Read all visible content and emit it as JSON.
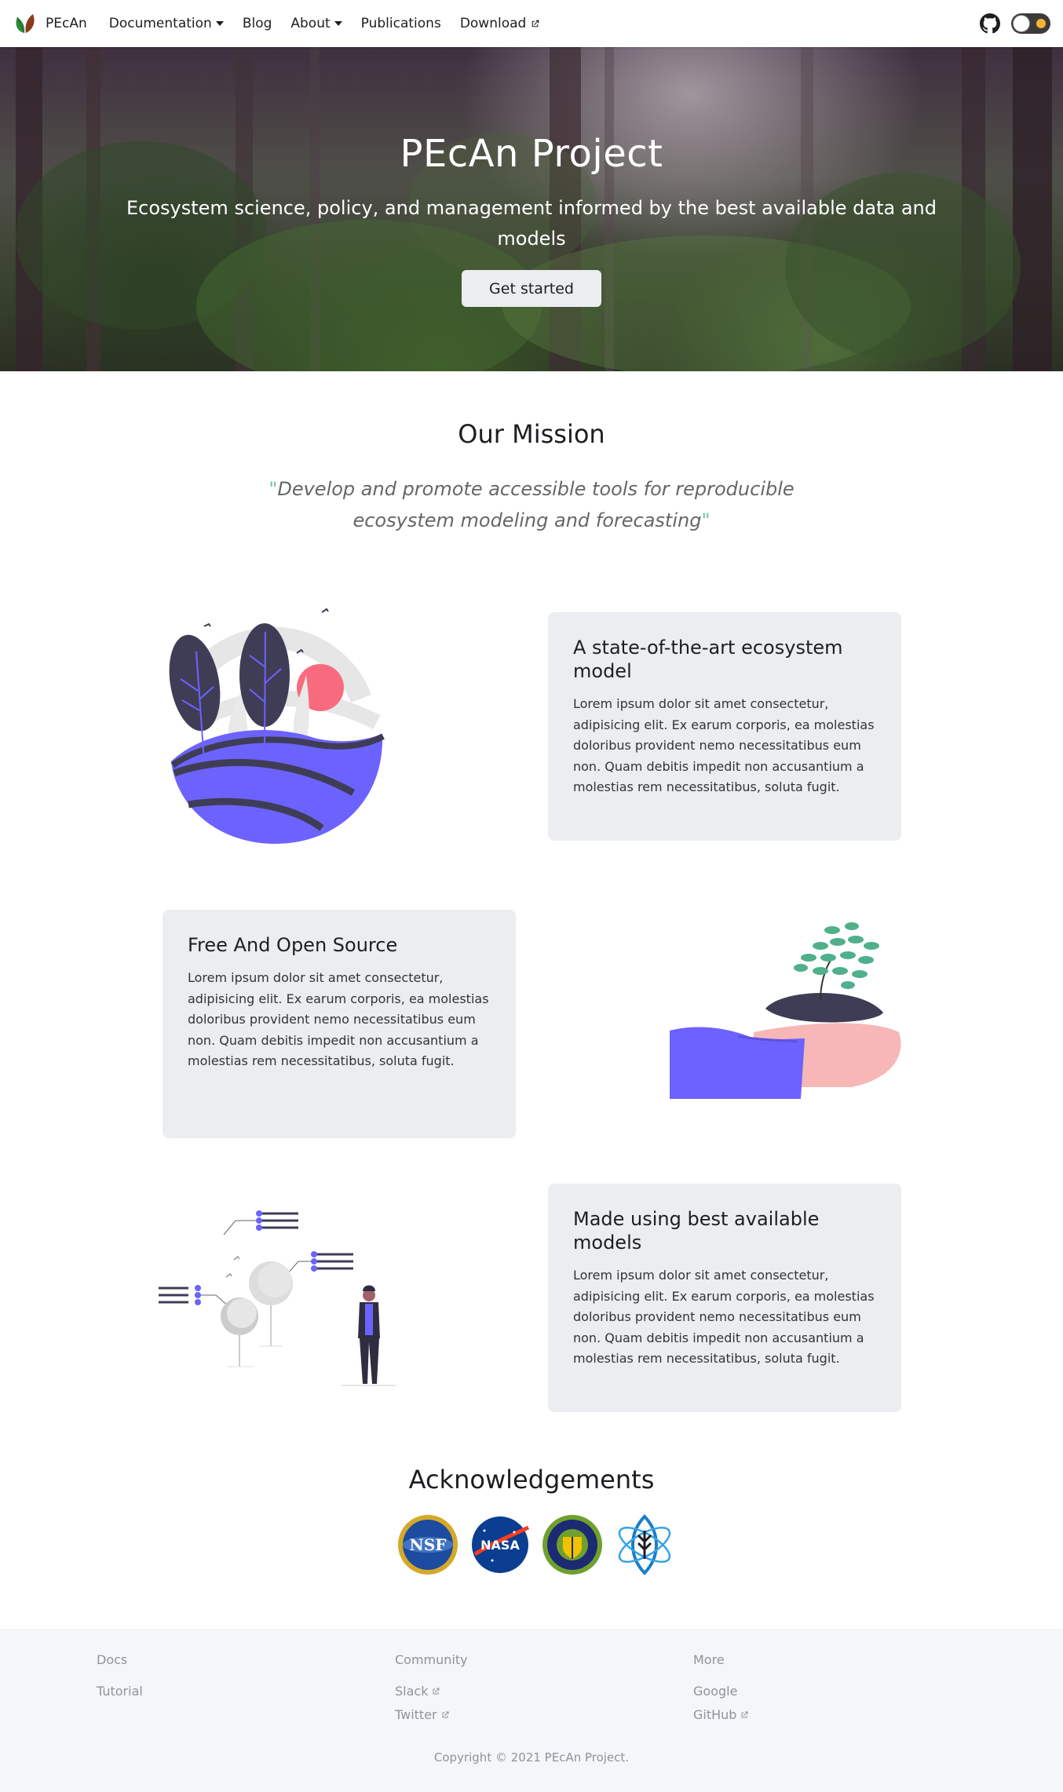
{
  "navbar": {
    "brand": "PEcAn",
    "items": [
      {
        "label": "Documentation",
        "dropdown": true
      },
      {
        "label": "Blog"
      },
      {
        "label": "About",
        "dropdown": true
      },
      {
        "label": "Publications"
      },
      {
        "label": "Download",
        "external": true
      }
    ],
    "icons": [
      "leaf-logo-icon",
      "github-icon",
      "theme-toggle"
    ]
  },
  "hero": {
    "title": "PEcAn Project",
    "subtitle": "Ecosystem science, policy, and management informed by the best available data and models",
    "button": "Get started"
  },
  "mission": {
    "title": "Our Mission",
    "quote_open": "\"",
    "quote": "Develop and promote accessible tools for reproducible ecosystem modeling and forecasting",
    "quote_close": "\""
  },
  "features": [
    {
      "title": "A state-of-the-art ecosystem model",
      "text": "Lorem ipsum dolor sit amet consectetur, adipisicing elit. Ex earum corporis, ea molestias doloribus provident nemo necessitatibus eum non. Quam debitis impedit non accusantium a molestias rem necessitatibus, soluta fugit.",
      "illustration": "nature-globe-illustration"
    },
    {
      "title": "Free And Open Source",
      "text": "Lorem ipsum dolor sit amet consectetur, adipisicing elit. Ex earum corporis, ea molestias doloribus provident nemo necessitatibus eum non. Quam debitis impedit non accusantium a molestias rem necessitatibus, soluta fugit.",
      "illustration": "hand-holding-plant-illustration"
    },
    {
      "title": "Made using best available models",
      "text": "Lorem ipsum dolor sit amet consectetur, adipisicing elit. Ex earum corporis, ea molestias doloribus provident nemo necessitatibus eum non. Quam debitis impedit non accusantium a molestias rem necessitatibus, soluta fugit.",
      "illustration": "person-with-data-trees-illustration"
    }
  ],
  "acknowledgements": {
    "title": "Acknowledgements",
    "logos": [
      "NSF",
      "NASA",
      "DOE",
      "ARPA-E"
    ]
  },
  "footer": {
    "columns": [
      {
        "title": "Docs",
        "links": [
          {
            "label": "Tutorial"
          }
        ]
      },
      {
        "title": "Community",
        "links": [
          {
            "label": "Slack",
            "external": true
          },
          {
            "label": "Twitter",
            "external": true
          }
        ]
      },
      {
        "title": "More",
        "links": [
          {
            "label": "Google"
          },
          {
            "label": "GitHub",
            "external": true
          }
        ]
      }
    ],
    "copyright": "Copyright © 2021 PEcAn Project."
  },
  "colors": {
    "accent": "#6c63ff",
    "card_bg": "#ebedf0",
    "footer_bg": "#f5f6f7",
    "quote_mark": "#6ec7a8",
    "leaf_green": "#2e8b3e",
    "leaf_brown": "#8b3a1e"
  }
}
